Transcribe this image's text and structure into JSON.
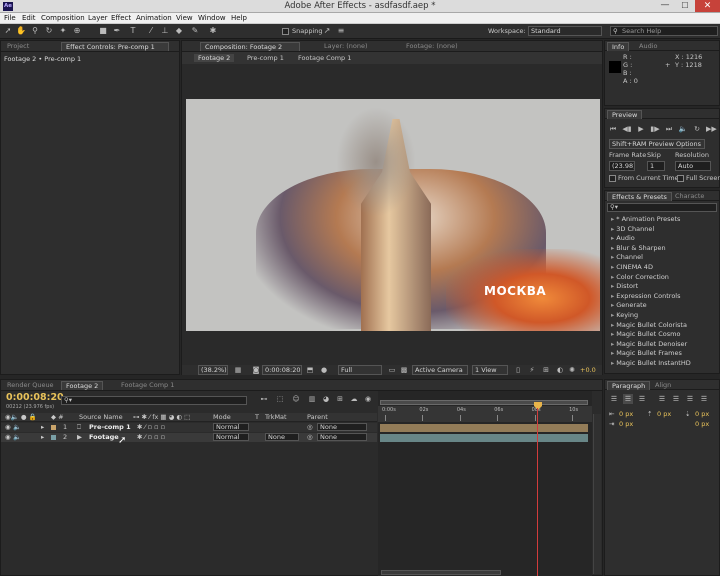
{
  "window": {
    "title": "Adobe After Effects - asdfasdf.aep *",
    "logo": "Ae"
  },
  "menu": [
    "File",
    "Edit",
    "Composition",
    "Layer",
    "Effect",
    "Animation",
    "View",
    "Window",
    "Help"
  ],
  "toolbar": {
    "snapping": "Snapping",
    "workspace_label": "Workspace:",
    "workspace_value": "Standard",
    "search_placeholder": "Search Help"
  },
  "project": {
    "tab": "Project",
    "effect_tab": "Effect Controls: Pre-comp 1",
    "path": "Footage 2 • Pre-comp 1"
  },
  "composition": {
    "tab": "Composition: Footage 2",
    "layer_tab": "Layer: (none)",
    "footage_tab": "Footage: (none)",
    "crumbs": [
      "Footage 2",
      "Pre-comp 1",
      "Footage Comp 1"
    ],
    "overlay_text": "МОСКВА",
    "zoom": "(38.2%)",
    "timecode": "0:00:08:20",
    "resolution": "Full",
    "camera": "Active Camera",
    "views": "1 View",
    "exposure": "+0.0"
  },
  "info": {
    "tab": "Info",
    "audio_tab": "Audio",
    "r": "R :",
    "g": "G :",
    "b": "B :",
    "a": "A : 0",
    "x": "X : 1216",
    "y": "Y : 1218"
  },
  "preview": {
    "tab": "Preview",
    "options": "Shift+RAM Preview Options",
    "frame_rate_label": "Frame Rate",
    "skip_label": "Skip",
    "resolution_label": "Resolution",
    "frame_rate": "(23.98)",
    "skip": "1",
    "resolution": "Auto",
    "from_current": "From Current Time",
    "full_screen": "Full Screen"
  },
  "effects": {
    "tab": "Effects & Presets",
    "char_tab": "Characte",
    "items": [
      "* Animation Presets",
      "3D Channel",
      "Audio",
      "Blur & Sharpen",
      "Channel",
      "CINEMA 4D",
      "Color Correction",
      "Distort",
      "Expression Controls",
      "Generate",
      "Keying",
      "Magic Bullet Colorista",
      "Magic Bullet Cosmo",
      "Magic Bullet Denoiser",
      "Magic Bullet Frames",
      "Magic Bullet InstantHD"
    ]
  },
  "timeline": {
    "tabs": [
      "Render Queue",
      "Footage 2",
      "Footage Comp 1"
    ],
    "timecode": "0:00:08:20",
    "fps": "00212 (23.976 fps)",
    "col_source": "Source Name",
    "col_mode": "Mode",
    "col_t": "T",
    "col_trkmat": "TrkMat",
    "col_parent": "Parent",
    "ruler": [
      "0:00s",
      "02s",
      "04s",
      "06s",
      "08s",
      "10s"
    ],
    "layers": [
      {
        "num": "1",
        "name": "Pre-comp 1",
        "mode": "Normal",
        "trkmat": "",
        "parent": "None",
        "color": "#c9a46b"
      },
      {
        "num": "2",
        "name": "Footage",
        "mode": "Normal",
        "trkmat": "None",
        "parent": "None",
        "color": "#7aa0a6"
      }
    ]
  },
  "paragraph": {
    "tab": "Paragraph",
    "align_tab": "Align",
    "fields": [
      "0 px",
      "0 px",
      "0 px",
      "0 px",
      "0 px"
    ]
  },
  "colors": {
    "playhead": "#d23c3c",
    "timecode": "#e8b44a",
    "layer1": "#b89a6a",
    "layer2": "#7fa7a8"
  }
}
